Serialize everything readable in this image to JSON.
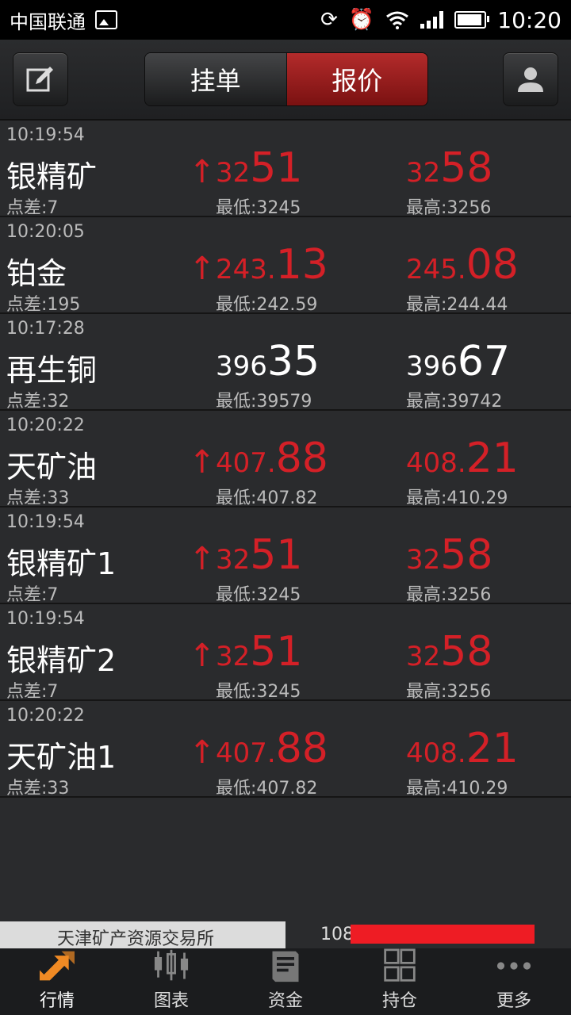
{
  "status_bar": {
    "carrier": "中国联通",
    "time": "10:20",
    "icons": [
      "image-icon",
      "sync-icon",
      "alarm-icon",
      "wifi-icon",
      "signal-icon",
      "battery-icon"
    ]
  },
  "header": {
    "left_button_icon": "edit-icon",
    "tabs": [
      {
        "label": "挂单",
        "active": false
      },
      {
        "label": "报价",
        "active": true
      }
    ],
    "right_button_icon": "user-icon"
  },
  "quotes": [
    {
      "time": "10:19:54",
      "name": "银精矿",
      "spread": "点差:7",
      "bid_prefix": "32",
      "bid_main": "51",
      "ask_prefix": "32",
      "ask_main": "58",
      "low": "最低:3245",
      "high": "最高:3256",
      "up": true
    },
    {
      "time": "10:20:05",
      "name": "铂金",
      "spread": "点差:195",
      "bid_prefix": "243.",
      "bid_main": "13",
      "ask_prefix": "245.",
      "ask_main": "08",
      "low": "最低:242.59",
      "high": "最高:244.44",
      "up": true
    },
    {
      "time": "10:17:28",
      "name": "再生铜",
      "spread": "点差:32",
      "bid_prefix": "396",
      "bid_main": "35",
      "ask_prefix": "396",
      "ask_main": "67",
      "low": "最低:39579",
      "high": "最高:39742",
      "up": false
    },
    {
      "time": "10:20:22",
      "name": "天矿油",
      "spread": "点差:33",
      "bid_prefix": "407.",
      "bid_main": "88",
      "ask_prefix": "408.",
      "ask_main": "21",
      "low": "最低:407.82",
      "high": "最高:410.29",
      "up": true
    },
    {
      "time": "10:19:54",
      "name": "银精矿1",
      "spread": "点差:7",
      "bid_prefix": "32",
      "bid_main": "51",
      "ask_prefix": "32",
      "ask_main": "58",
      "low": "最低:3245",
      "high": "最高:3256",
      "up": true
    },
    {
      "time": "10:19:54",
      "name": "银精矿2",
      "spread": "点差:7",
      "bid_prefix": "32",
      "bid_main": "51",
      "ask_prefix": "32",
      "ask_main": "58",
      "low": "最低:3245",
      "high": "最高:3256",
      "up": true
    },
    {
      "time": "10:20:22",
      "name": "天矿油1",
      "spread": "点差:33",
      "bid_prefix": "407.",
      "bid_main": "88",
      "ask_prefix": "408.",
      "ask_main": "21",
      "low": "最低:407.82",
      "high": "最高:410.29",
      "up": true
    }
  ],
  "up_arrow": "↑",
  "exchange": {
    "name": "天津矿产资源交易所",
    "account_prefix": "108"
  },
  "tabbar": [
    {
      "label": "行情",
      "icon": "market-arrows-icon",
      "active": true
    },
    {
      "label": "图表",
      "icon": "candlestick-chart-icon",
      "active": false
    },
    {
      "label": "资金",
      "icon": "funds-book-icon",
      "active": false
    },
    {
      "label": "持仓",
      "icon": "positions-grid-icon",
      "active": false
    },
    {
      "label": "更多",
      "icon": "more-dots-icon",
      "active": false
    }
  ],
  "colors": {
    "price_red": "#d42027",
    "active_tab": "#b32b2b",
    "accent_orange": "#f08a24",
    "background": "#2a2b2d"
  }
}
